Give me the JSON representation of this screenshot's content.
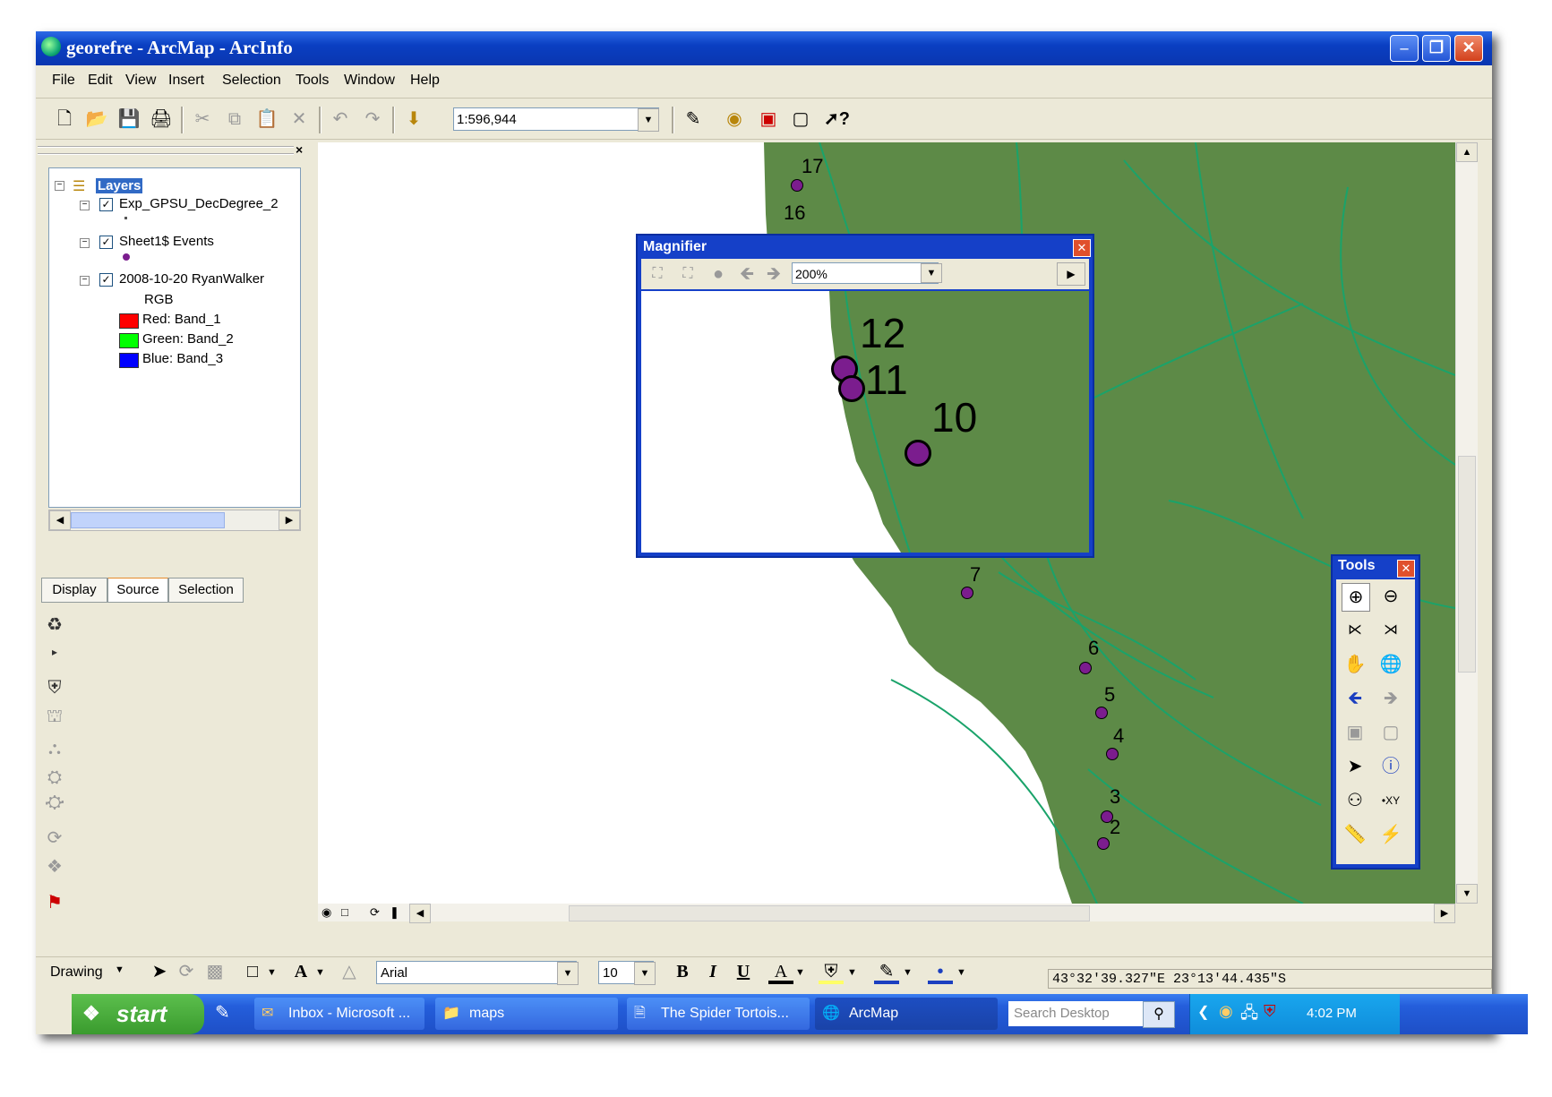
{
  "window": {
    "title": "georefre - ArcMap - ArcInfo"
  },
  "menu": [
    "File",
    "Edit",
    "View",
    "Insert",
    "Selection",
    "Tools",
    "Window",
    "Help"
  ],
  "toolbar": {
    "scale": "1:596,944"
  },
  "toc": {
    "root": "Layers",
    "layers": [
      {
        "name": "Exp_GPSU_DecDegree_2",
        "checked": true
      },
      {
        "name": "Sheet1$ Events",
        "checked": true
      },
      {
        "name": "2008-10-20 RyanWalker",
        "checked": true,
        "sublabel": "RGB"
      }
    ],
    "bands": [
      {
        "label": "Red:   Band_1",
        "color": "#ff0000"
      },
      {
        "label": "Green: Band_2",
        "color": "#00ff00"
      },
      {
        "label": "Blue:   Band_3",
        "color": "#0000ff"
      }
    ],
    "tabs": [
      "Display",
      "Source",
      "Selection"
    ]
  },
  "map": {
    "land_color": "#5d8a47",
    "road_color": "#1aa36a",
    "point_color": "#7b1d8e",
    "point_labels": [
      "17",
      "16",
      "7",
      "6",
      "5",
      "4",
      "3",
      "2"
    ]
  },
  "magnifier": {
    "title": "Magnifier",
    "zoom": "200%",
    "point_labels": [
      "12",
      "11",
      "10"
    ]
  },
  "tools_window": {
    "title": "Tools"
  },
  "drawing": {
    "label": "Drawing",
    "font": "Arial",
    "size": "10"
  },
  "status": {
    "coords": "43°32'39.327\"E  23°13'44.435\"S"
  },
  "taskbar": {
    "start": "start",
    "tasks": [
      "Inbox - Microsoft ...",
      "maps",
      "The Spider Tortois...",
      "ArcMap"
    ],
    "search_placeholder": "Search Desktop",
    "clock": "4:02 PM"
  }
}
